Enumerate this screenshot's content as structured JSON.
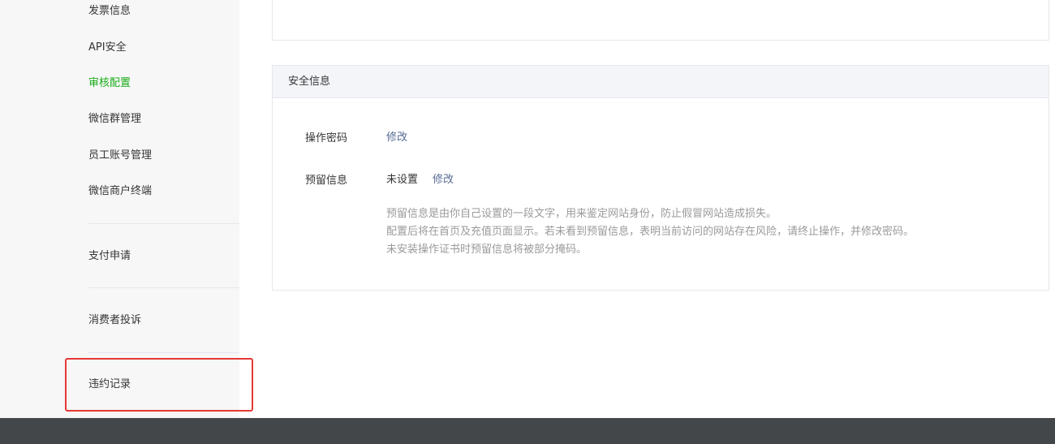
{
  "sidebar": {
    "items": [
      {
        "label": "发票信息"
      },
      {
        "label": "API安全"
      },
      {
        "label": "审核配置",
        "active": true
      },
      {
        "label": "微信群管理"
      },
      {
        "label": "员工账号管理"
      },
      {
        "label": "微信商户终端"
      }
    ],
    "pay_apply": "支付申请",
    "complaints": "消费者投诉",
    "violation": "违约记录"
  },
  "security": {
    "title": "安全信息",
    "password": {
      "label": "操作密码",
      "action": "修改"
    },
    "reserved": {
      "label": "预留信息",
      "status": "未设置",
      "action": "修改"
    },
    "desc": [
      "预留信息是由你自己设置的一段文字，用来鉴定网站身份，防止假冒网站造成损失。",
      "配置后将在首页及充值页面显示。若未看到预留信息，表明当前访问的网站存在风险，请终止操作，并修改密码。",
      "未安装操作证书时预留信息将被部分掩码。"
    ]
  },
  "colors": {
    "active_green": "#1aad19",
    "link_blue": "#576b95",
    "highlight_red": "#e53935",
    "footer_bg": "#44474a"
  }
}
